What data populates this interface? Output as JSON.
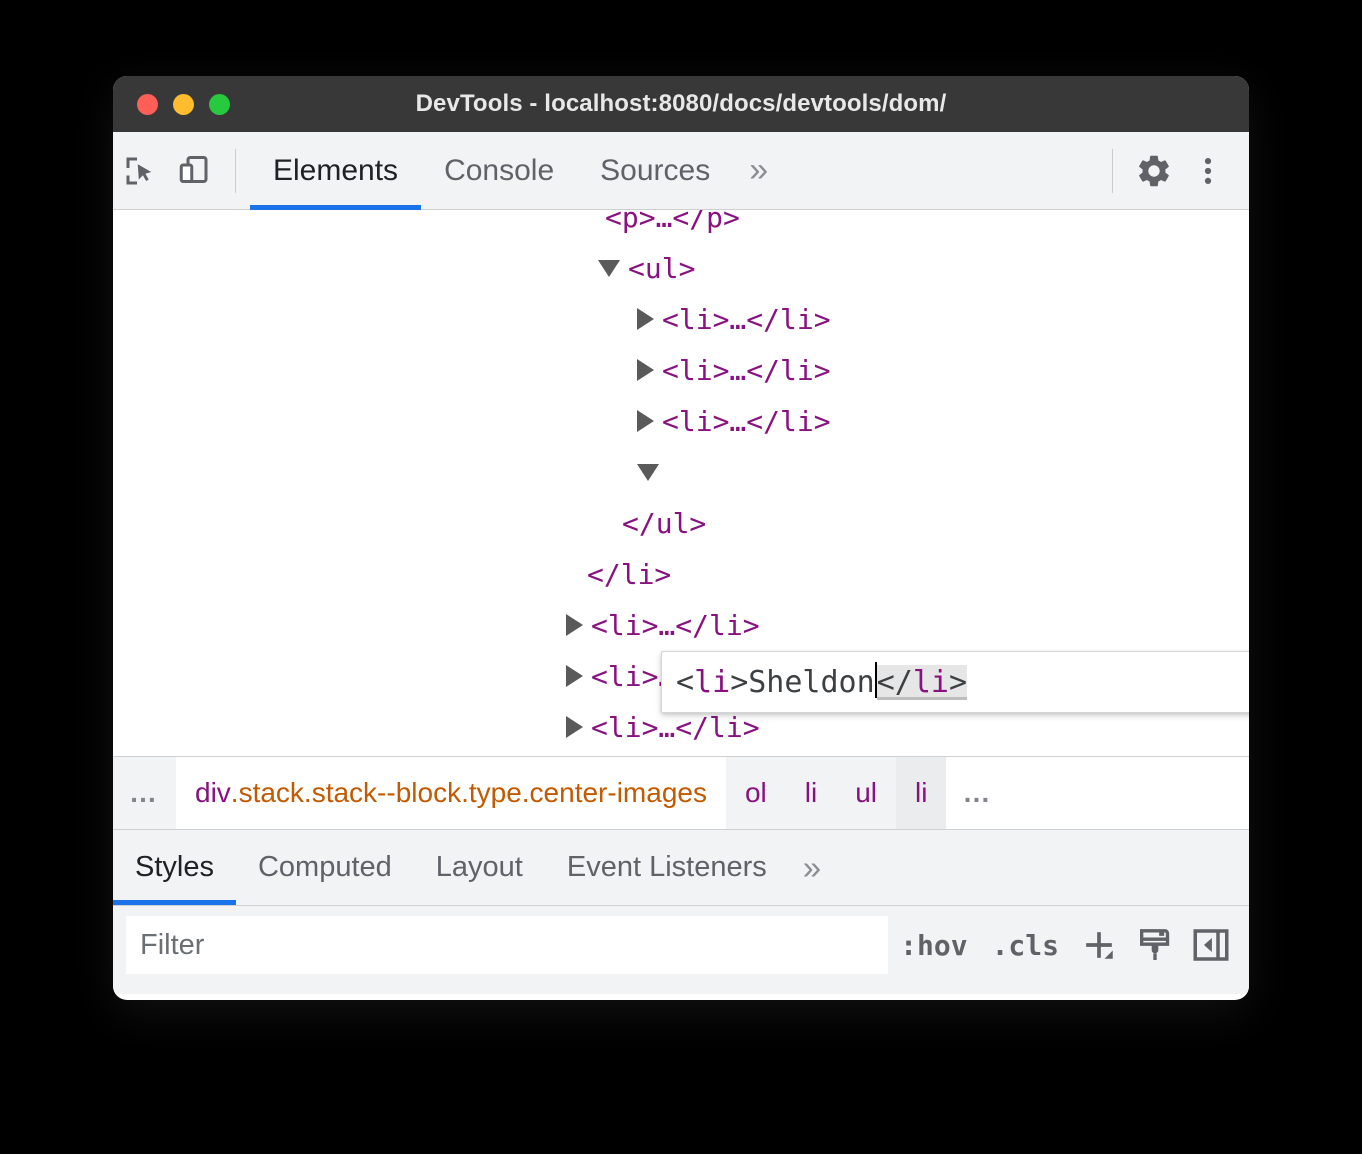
{
  "window": {
    "title": "DevTools - localhost:8080/docs/devtools/dom/",
    "traffic_lights": {
      "close": "close-window",
      "minimize": "minimize-window",
      "zoom": "zoom-window"
    },
    "colors": {
      "titlebar_bg": "#383838",
      "toolbar_bg": "#f1f3f4",
      "accent": "#1a73e8",
      "tag_purple": "#881280",
      "class_orange": "#c15a00",
      "traffic_red": "#FF5F56",
      "traffic_yellow": "#FEBC2E",
      "traffic_green": "#27C93F"
    }
  },
  "toolbar": {
    "inspect_icon": "inspect-element-icon",
    "device_icon": "device-toolbar-icon",
    "tabs": [
      {
        "label": "Elements",
        "active": true
      },
      {
        "label": "Console",
        "active": false
      },
      {
        "label": "Sources",
        "active": false
      }
    ],
    "more_tabs_label": "»",
    "settings_icon": "gear-icon",
    "menu_icon": "kebab-menu-icon"
  },
  "dom_tree": {
    "rows": [
      {
        "indent": 0,
        "marker": "none",
        "text": "<p>…</p>",
        "clipped": true
      },
      {
        "indent": 0,
        "marker": "open",
        "text": "<ul>"
      },
      {
        "indent": 1,
        "marker": "closed",
        "text": "<li>…</li>"
      },
      {
        "indent": 1,
        "marker": "closed",
        "text": "<li>…</li>"
      },
      {
        "indent": 1,
        "marker": "closed",
        "text": "<li>…</li>"
      },
      {
        "indent": 1,
        "marker": "open",
        "text": "",
        "editing": true
      },
      {
        "indent": 0,
        "marker": "none",
        "text": "</ul>"
      },
      {
        "indent": -1,
        "marker": "none",
        "text": "</li>"
      },
      {
        "indent": -1,
        "marker": "closed",
        "text": "<li>…</li>"
      },
      {
        "indent": -1,
        "marker": "closed",
        "text": "<li>…</li>"
      },
      {
        "indent": -1,
        "marker": "closed",
        "text": "<li>…</li>"
      }
    ],
    "edit_box": {
      "open_lt": "<",
      "open_tag": "li",
      "open_gt": ">",
      "text_value": "Sheldon",
      "close_lt": "</",
      "close_tag": "li",
      "close_gt": ">",
      "caret_after": "Sheldon",
      "selection": "</li>"
    }
  },
  "breadcrumb": {
    "leading_dots": "…",
    "items": [
      {
        "tag": "div",
        "classes": ".stack.stack--block.type.center-images",
        "state": "selected"
      },
      {
        "tag": "ol",
        "classes": "",
        "state": "normal"
      },
      {
        "tag": "li",
        "classes": "",
        "state": "normal"
      },
      {
        "tag": "ul",
        "classes": "",
        "state": "normal"
      },
      {
        "tag": "li",
        "classes": "",
        "state": "hovered"
      }
    ],
    "trailing_dots": "…"
  },
  "styles_panel": {
    "tabs": [
      {
        "label": "Styles",
        "active": true
      },
      {
        "label": "Computed",
        "active": false
      },
      {
        "label": "Layout",
        "active": false
      },
      {
        "label": "Event Listeners",
        "active": false
      }
    ],
    "more_tabs_label": "»",
    "filter": {
      "placeholder": "Filter",
      "value": ""
    },
    "hov_label": ":hov",
    "cls_label": ".cls",
    "new_rule_icon": "plus-new-style-rule-icon",
    "color_picker_icon": "paintbrush-icon",
    "toggle_sidebar_icon": "toggle-sidebar-icon"
  }
}
